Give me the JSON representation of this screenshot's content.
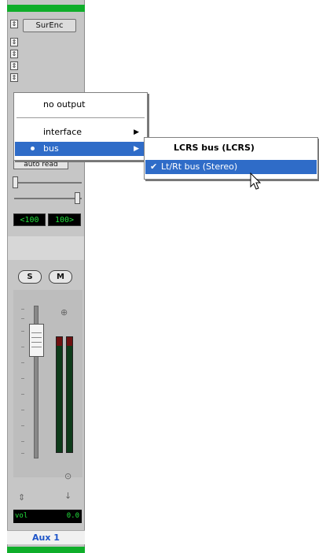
{
  "strip": {
    "insert_label": "SurEnc",
    "automation_mode": "auto read",
    "pan_left": "<100",
    "pan_right": "100>",
    "solo_label": "S",
    "mute_label": "M",
    "volume_label": "vol",
    "volume_value": "0.0",
    "track_name": "Aux 1"
  },
  "menu": {
    "items": [
      {
        "label": "no output"
      },
      {
        "label": "interface",
        "submenu_arrow": "▶"
      },
      {
        "label": "bus",
        "submenu_arrow": "▶"
      }
    ]
  },
  "submenu": {
    "items": [
      {
        "label": "LCRS bus (LCRS)"
      },
      {
        "label": "Lt/Rt bus (Stereo)",
        "check": "✔"
      }
    ]
  },
  "colors": {
    "highlight": "#2f6cc8",
    "meter_green": "#22e03c",
    "strip_green": "#0fae2a",
    "track_name": "#1e55c8"
  }
}
